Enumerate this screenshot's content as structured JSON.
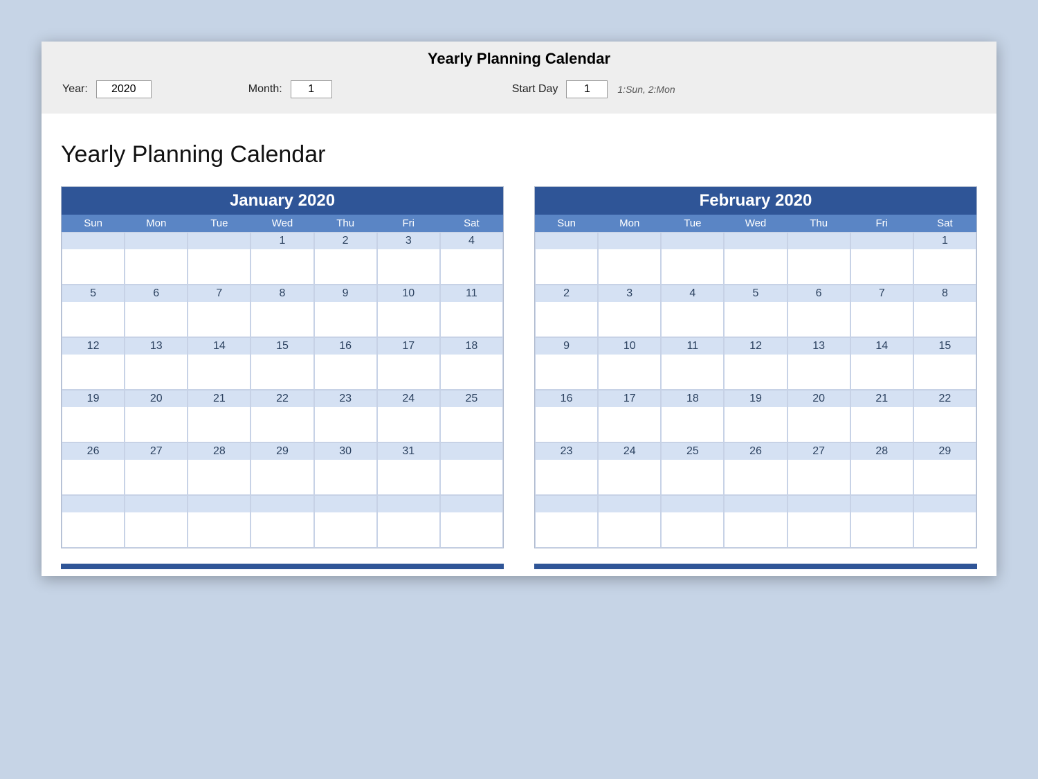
{
  "config": {
    "title": "Yearly Planning Calendar",
    "year_label": "Year:",
    "year_value": "2020",
    "month_label": "Month:",
    "month_value": "1",
    "startday_label": "Start Day",
    "startday_value": "1",
    "startday_hint": "1:Sun, 2:Mon"
  },
  "page_title": "Yearly Planning Calendar",
  "day_names": [
    "Sun",
    "Mon",
    "Tue",
    "Wed",
    "Thu",
    "Fri",
    "Sat"
  ],
  "months": [
    {
      "header": "January 2020",
      "weeks": [
        [
          "",
          "",
          "",
          "1",
          "2",
          "3",
          "4"
        ],
        [
          "5",
          "6",
          "7",
          "8",
          "9",
          "10",
          "11"
        ],
        [
          "12",
          "13",
          "14",
          "15",
          "16",
          "17",
          "18"
        ],
        [
          "19",
          "20",
          "21",
          "22",
          "23",
          "24",
          "25"
        ],
        [
          "26",
          "27",
          "28",
          "29",
          "30",
          "31",
          ""
        ],
        [
          "",
          "",
          "",
          "",
          "",
          "",
          ""
        ]
      ]
    },
    {
      "header": "February 2020",
      "weeks": [
        [
          "",
          "",
          "",
          "",
          "",
          "",
          "1"
        ],
        [
          "2",
          "3",
          "4",
          "5",
          "6",
          "7",
          "8"
        ],
        [
          "9",
          "10",
          "11",
          "12",
          "13",
          "14",
          "15"
        ],
        [
          "16",
          "17",
          "18",
          "19",
          "20",
          "21",
          "22"
        ],
        [
          "23",
          "24",
          "25",
          "26",
          "27",
          "28",
          "29"
        ],
        [
          "",
          "",
          "",
          "",
          "",
          "",
          ""
        ]
      ]
    }
  ]
}
